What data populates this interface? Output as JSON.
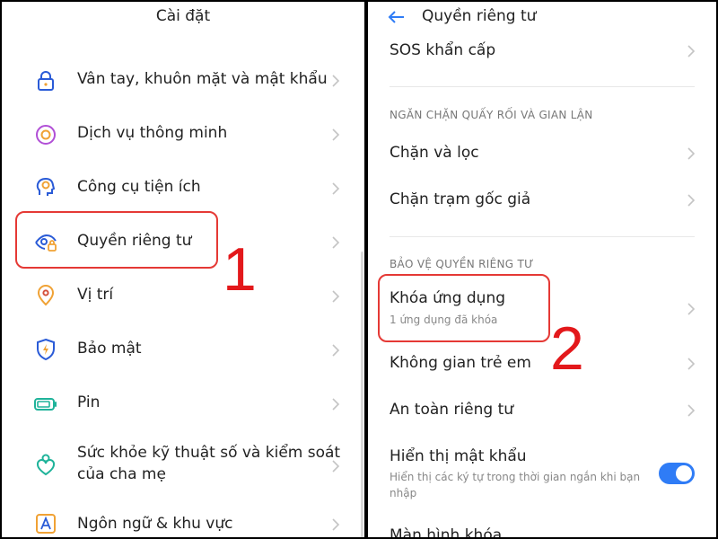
{
  "left": {
    "title": "Cài đặt",
    "items": [
      {
        "label": "Vân tay, khuôn mặt và mật khẩu",
        "icon": "lock-icon"
      },
      {
        "label": "Dịch vụ thông minh",
        "icon": "smart-service-icon"
      },
      {
        "label": "Công cụ tiện ích",
        "icon": "tools-icon"
      },
      {
        "label": "Quyền riêng tư",
        "icon": "privacy-eye-lock-icon"
      },
      {
        "label": "Vị trí",
        "icon": "location-pin-icon"
      },
      {
        "label": "Bảo mật",
        "icon": "shield-bolt-icon"
      },
      {
        "label": "Pin",
        "icon": "battery-icon"
      },
      {
        "label_line1": "Sức khỏe kỹ thuật số và kiểm soát",
        "label_line2": "của cha mẹ",
        "icon": "digital-wellbeing-icon"
      },
      {
        "label": "Ngôn ngữ & khu vực",
        "icon": "language-icon"
      }
    ],
    "step_number": "1"
  },
  "right": {
    "title": "Quyền riêng tư",
    "sos": "SOS khẩn cấp",
    "section1": "NGĂN CHẶN QUẤY RỐI VÀ GIAN LẬN",
    "block_filter": "Chặn và lọc",
    "block_fake_station": "Chặn trạm gốc giả",
    "section2": "BẢO VỆ QUYỀN RIÊNG TƯ",
    "app_lock": "Khóa ứng dụng",
    "app_lock_sub": "1 ứng dụng đã khóa",
    "kids_space": "Không gian trẻ em",
    "privacy_safety": "An toàn riêng tư",
    "show_password": "Hiển thị mật khẩu",
    "show_password_sub_line1": "Hiển thị các ký tự trong thời gian ngắn khi bạn",
    "show_password_sub_line2": "nhập",
    "show_password_on": true,
    "lock_screen": "Màn hình khóa",
    "step_number": "2"
  },
  "colors": {
    "highlight": "#e53935",
    "accent": "#2f7cf6",
    "icon_orange": "#f0a235",
    "icon_blue": "#2a5bd7",
    "icon_teal": "#1fb39a",
    "icon_purple": "#b14fd6"
  }
}
